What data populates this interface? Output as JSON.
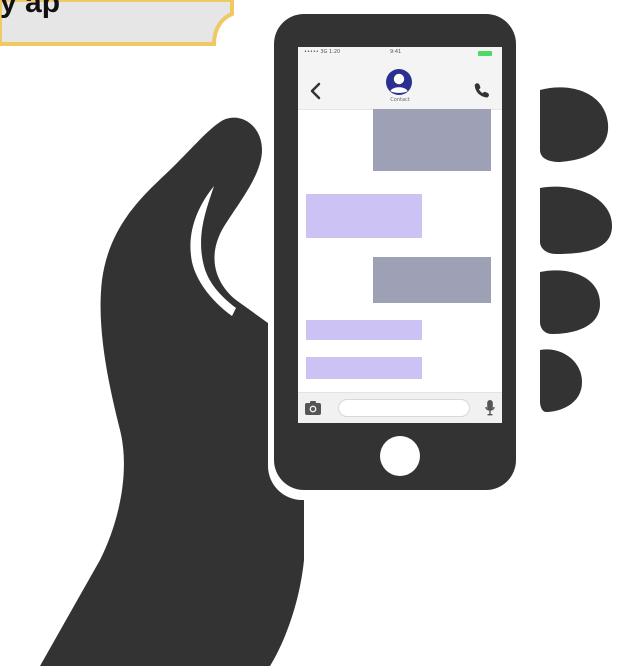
{
  "speech_fragment": {
    "text": "y ap"
  },
  "phone": {
    "status": {
      "left": "••••• 3G 1:20",
      "center": "9:41"
    },
    "header": {
      "contact_name": "Contact"
    },
    "messages": [
      {
        "side": "out"
      },
      {
        "side": "in"
      },
      {
        "side": "out"
      },
      {
        "side": "in"
      },
      {
        "side": "in"
      }
    ],
    "input": {
      "placeholder": ""
    }
  },
  "colors": {
    "silhouette": "#333333",
    "phone_body": "#333333",
    "outgoing_bubble": "#9ea1b5",
    "incoming_bubble": "#ccc3f4",
    "avatar": "#2b2f8f",
    "speech_bubble_fill": "#e6e6e6",
    "speech_bubble_border": "#f0c864"
  }
}
